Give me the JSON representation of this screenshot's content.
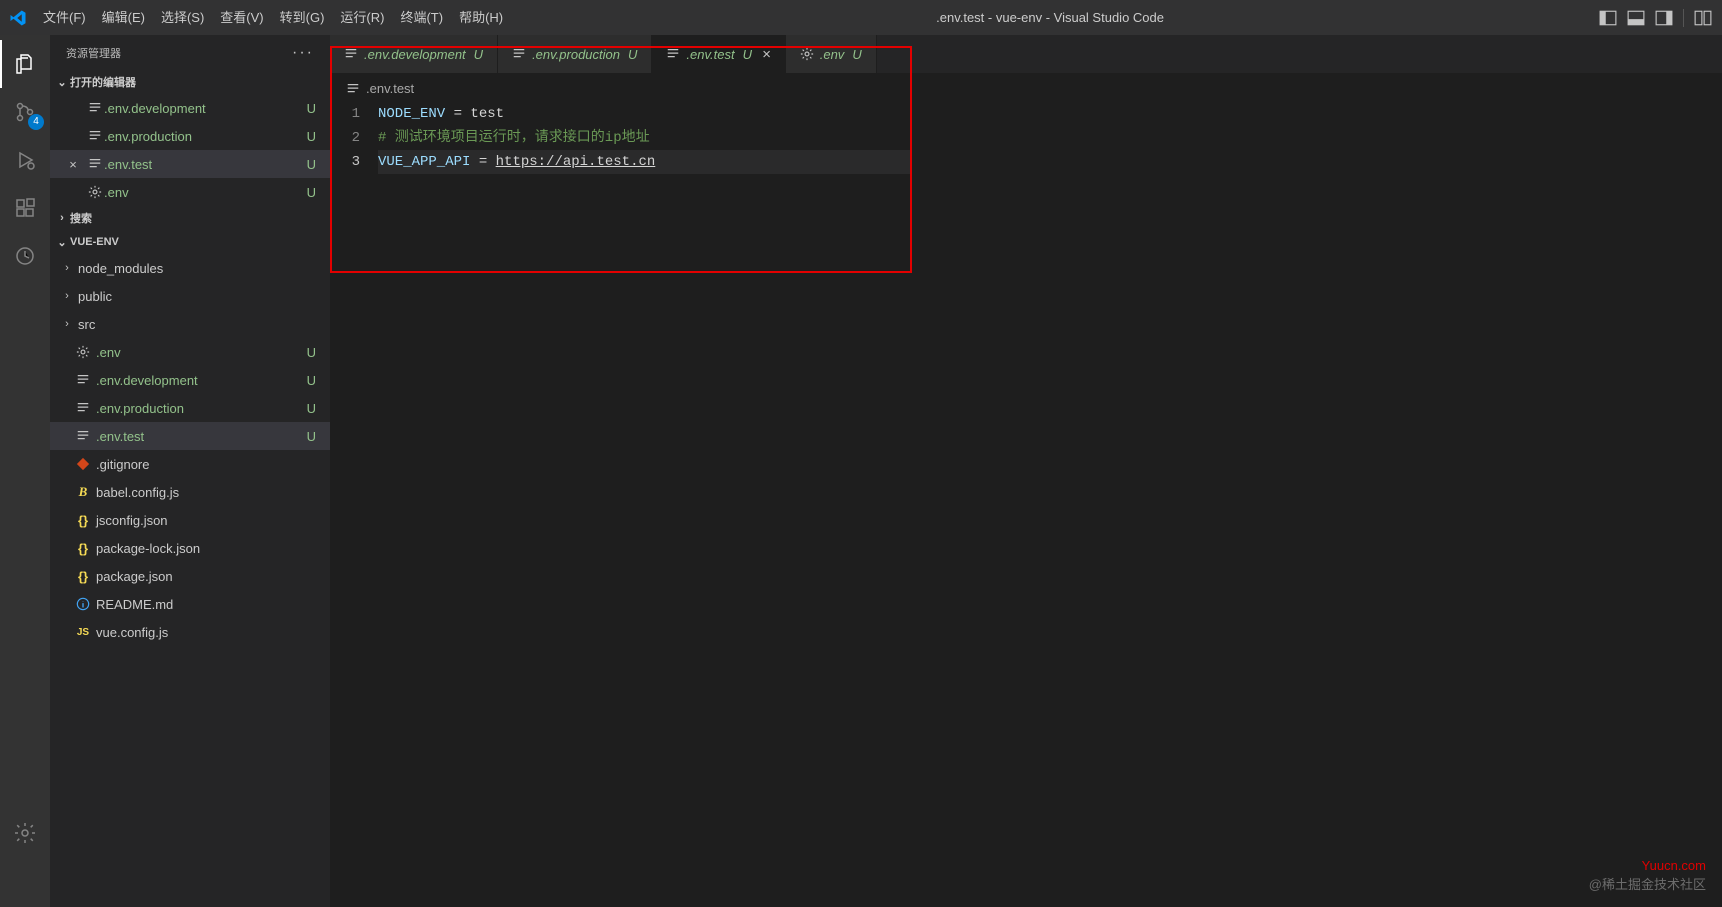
{
  "window_title": ".env.test - vue-env - Visual Studio Code",
  "menu": [
    {
      "label": "文件(F)"
    },
    {
      "label": "编辑(E)"
    },
    {
      "label": "选择(S)"
    },
    {
      "label": "查看(V)"
    },
    {
      "label": "转到(G)"
    },
    {
      "label": "运行(R)"
    },
    {
      "label": "终端(T)"
    },
    {
      "label": "帮助(H)"
    }
  ],
  "sidebar": {
    "title": "资源管理器",
    "open_editors": {
      "label": "打开的编辑器",
      "items": [
        {
          "name": ".env.development",
          "status": "U",
          "icon": "lines",
          "modified": true
        },
        {
          "name": ".env.production",
          "status": "U",
          "icon": "lines",
          "modified": true
        },
        {
          "name": ".env.test",
          "status": "U",
          "icon": "lines",
          "modified": true,
          "active": true,
          "close": true
        },
        {
          "name": ".env",
          "status": "U",
          "icon": "gear",
          "modified": true
        }
      ]
    },
    "search": {
      "label": "搜索"
    },
    "project": {
      "label": "VUE-ENV",
      "tree": [
        {
          "type": "folder",
          "name": "node_modules"
        },
        {
          "type": "folder",
          "name": "public"
        },
        {
          "type": "folder",
          "name": "src"
        },
        {
          "type": "file",
          "name": ".env",
          "icon": "gear",
          "status": "U",
          "modified": true
        },
        {
          "type": "file",
          "name": ".env.development",
          "icon": "lines",
          "status": "U",
          "modified": true
        },
        {
          "type": "file",
          "name": ".env.production",
          "icon": "lines",
          "status": "U",
          "modified": true
        },
        {
          "type": "file",
          "name": ".env.test",
          "icon": "lines",
          "status": "U",
          "modified": true,
          "active": true
        },
        {
          "type": "file",
          "name": ".gitignore",
          "icon": "git",
          "color": "#e64a19"
        },
        {
          "type": "file",
          "name": "babel.config.js",
          "icon": "babel",
          "color": "#f5da55"
        },
        {
          "type": "file",
          "name": "jsconfig.json",
          "icon": "json",
          "color": "#f5da55"
        },
        {
          "type": "file",
          "name": "package-lock.json",
          "icon": "json",
          "color": "#f5da55"
        },
        {
          "type": "file",
          "name": "package.json",
          "icon": "json",
          "color": "#f5da55"
        },
        {
          "type": "file",
          "name": "README.md",
          "icon": "info",
          "color": "#42a5f5"
        },
        {
          "type": "file",
          "name": "vue.config.js",
          "icon": "js",
          "color": "#f5da55"
        }
      ]
    }
  },
  "scm_badge": "4",
  "tabs": [
    {
      "label": ".env.development",
      "status": "U",
      "icon": "lines"
    },
    {
      "label": ".env.production",
      "status": "U",
      "icon": "lines"
    },
    {
      "label": ".env.test",
      "status": "U",
      "icon": "lines",
      "active": true,
      "close": true
    },
    {
      "label": ".env",
      "status": "U",
      "icon": "gear"
    }
  ],
  "breadcrumb": {
    "file": ".env.test"
  },
  "editor": {
    "lines": [
      {
        "n": "1",
        "tokens": [
          {
            "t": "var",
            "v": "NODE_ENV"
          },
          {
            "t": "txt",
            "v": " = test"
          }
        ]
      },
      {
        "n": "2",
        "tokens": [
          {
            "t": "comment",
            "v": "# 测试环境项目运行时，请求接口的ip地址"
          }
        ]
      },
      {
        "n": "3",
        "hl": true,
        "tokens": [
          {
            "t": "var",
            "v": "VUE_APP_API"
          },
          {
            "t": "txt",
            "v": " = "
          },
          {
            "t": "url",
            "v": "https://api.test.cn"
          }
        ]
      }
    ]
  },
  "watermark": {
    "line1": "Yuucn.com",
    "line2": "@稀土掘金技术社区"
  }
}
